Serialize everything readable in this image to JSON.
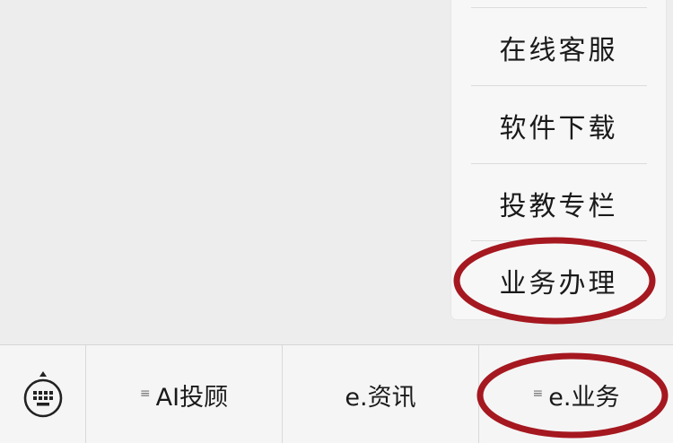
{
  "submenu": {
    "items": [
      {
        "label": "在线客服"
      },
      {
        "label": "软件下载"
      },
      {
        "label": "投教专栏"
      },
      {
        "label": "业务办理"
      }
    ]
  },
  "menubar": {
    "keyboard_icon": "keyboard-icon",
    "menu_glyph": "≡",
    "tabs": [
      {
        "label": "AI投顾",
        "has_glyph": true
      },
      {
        "label": "e.资讯",
        "has_glyph": false
      },
      {
        "label": "e.业务",
        "has_glyph": true
      }
    ]
  },
  "annotation_color": "#a51820",
  "colors": {
    "background": "#ededed",
    "menubar": "#f5f5f5",
    "submenu": "#f7f7f7"
  }
}
